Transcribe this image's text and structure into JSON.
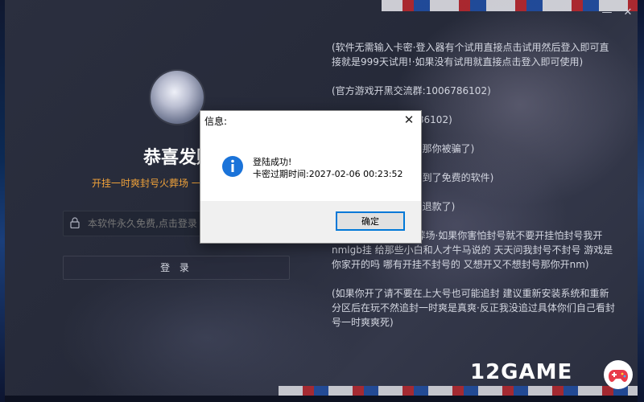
{
  "window": {
    "minimize_glyph": "—",
    "close_glyph": "✕"
  },
  "login": {
    "title": "恭喜发财",
    "subtitle": "开挂一时爽封号火葬场 一",
    "card_placeholder": "本软件永久免费,点击登录",
    "login_button": "登 录"
  },
  "notes": [
    "(软件无需输入卡密·登入器有个试用直接点击试用然后登入即可直接就是999天试用!·如果没有试用就直接点击登入即可使用)",
    "(官方游戏开黑交流群:1006786102)",
    "(官方交流群:1006786102)",
    "(如果收费购买的软件那你被骗了)",
    "(感谢死的商家让你买到了免费的软件)",
    "(没退款的抓紧时间去退款了)",
    "(开挂一时爽·封号火葬场·如果你害怕封号就不要开挂怕封号我开nmlgb挂 给那些小白和人才牛马说的 天天问我封号不封号 游戏是你家开的吗 哪有开挂不封号的 又想开又不想封号那你开nm)",
    "(如果你开了请不要在上大号也可能追封 建议重新安装系统和重新分区后在玩不然追封一时爽是真爽·反正我没追过具体你们自己看封号一时爽爽死)"
  ],
  "brand": {
    "text": "12GAME",
    "logo_icon": "gamepad-icon"
  },
  "dialog": {
    "title": "信息:",
    "close_glyph": "✕",
    "icon": "info-icon",
    "message_line1": "登陆成功!",
    "message_line2": "卡密过期时间:2027-02-06 00:23:52",
    "ok_label": "确定"
  },
  "colors": {
    "subtitle": "#f0a23a",
    "dialog_button_border": "#0078d7",
    "info_icon": "#1a73d9"
  }
}
